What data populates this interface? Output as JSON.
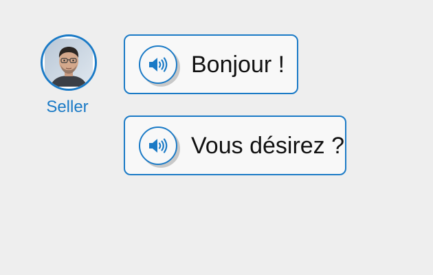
{
  "speaker": {
    "name": "Seller"
  },
  "dialogue": [
    {
      "text": "Bonjour !"
    },
    {
      "text": "Vous désirez ?"
    }
  ],
  "colors": {
    "accent": "#1a7ac6",
    "background": "#eeeeee",
    "bubble_fill": "#f8f8f8",
    "text": "#111111"
  },
  "icons": {
    "audio": "speaker-volume-icon"
  }
}
